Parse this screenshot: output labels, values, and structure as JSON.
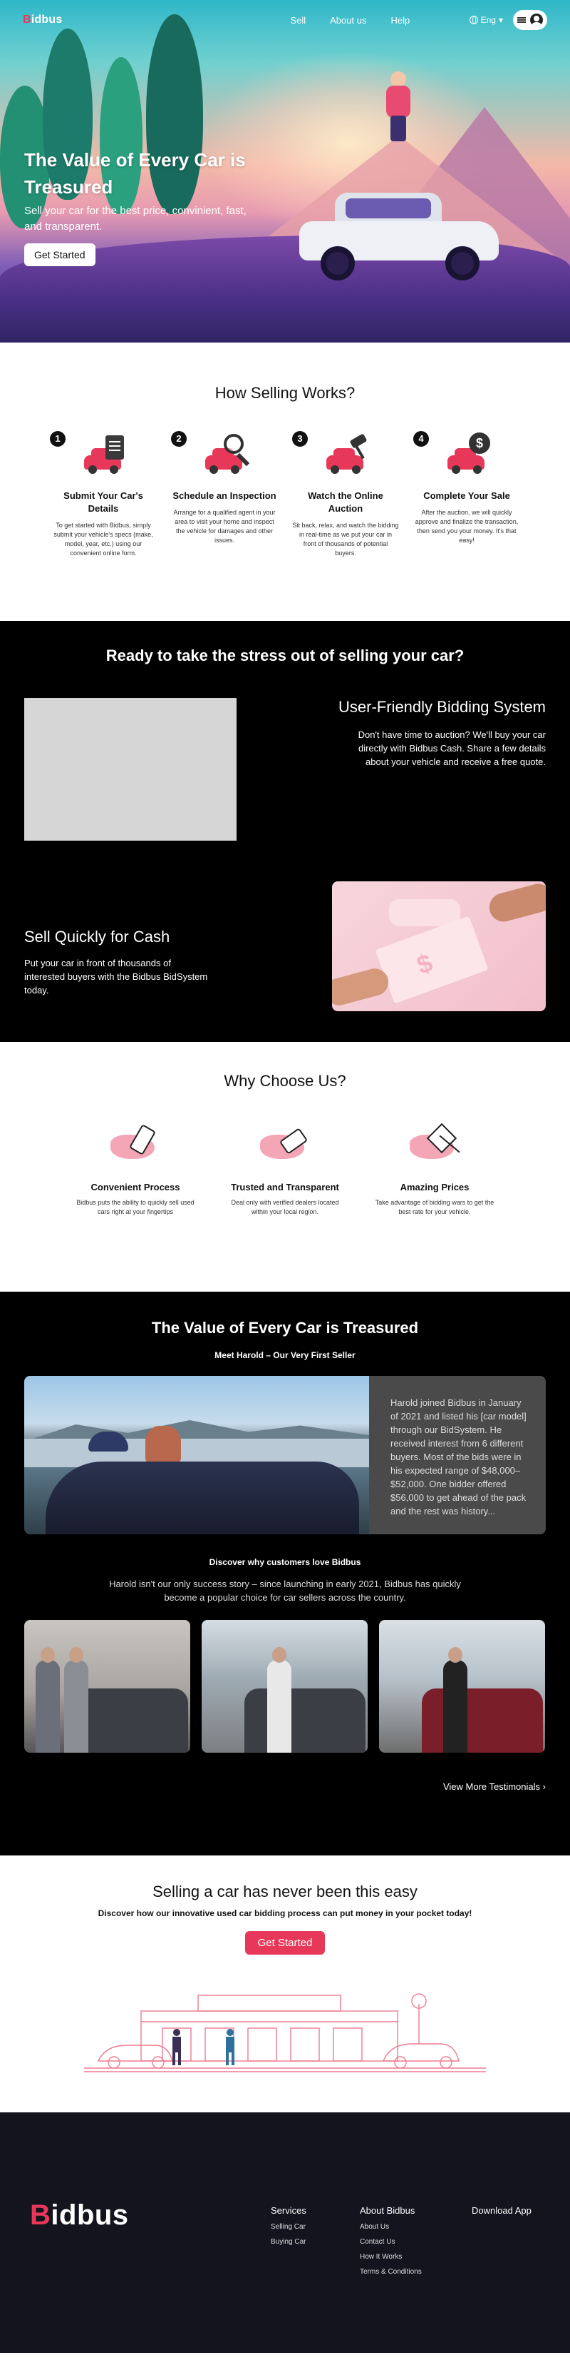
{
  "nav": {
    "logo_prefix": "B",
    "logo_rest": "idbus",
    "links": [
      "Sell",
      "About us",
      "Help"
    ],
    "language": "Eng",
    "language_caret": "▾"
  },
  "hero": {
    "title": "The Value of Every Car is Treasured",
    "subtitle": "Sell your car for the best price, convinient, fast, and transparent.",
    "cta": "Get Started"
  },
  "how": {
    "title": "How Selling Works?",
    "steps": [
      {
        "num": "1",
        "title": "Submit Your Car's Details",
        "text": "To get started with Bidbus, simply submit your vehicle's specs (make, model, year, etc.) using our convenient online form."
      },
      {
        "num": "2",
        "title": "Schedule an Inspection",
        "text": "Arrange for a qualified agent in your area to visit your home and inspect the vehicle for damages and other issues."
      },
      {
        "num": "3",
        "title": "Watch the Online Auction",
        "text": "Sit back, relax, and watch the bidding in real-time as we put your car in front of thousands of potential buyers."
      },
      {
        "num": "4",
        "title": "Complete Your Sale",
        "text": "After the auction, we will quickly approve and finalize the transaction, then send you your money. It's that easy!"
      }
    ]
  },
  "bidding": {
    "title": "Ready to take the stress out of selling your car?",
    "ubs_title": "User-Friendly Bidding System",
    "ubs_text": "Don't have time to auction? We'll buy your car directly with Bidbus Cash. Share a few details about your vehicle and receive a free quote.",
    "cash_title": "Sell Quickly for Cash",
    "cash_text": "Put your car in front of thousands of interested buyers with the Bidbus BidSystem today.",
    "cash_symbol": "$"
  },
  "why": {
    "title": "Why Choose Us?",
    "items": [
      {
        "title": "Convenient Process",
        "text": "Bidbus puts the ability to quickly sell used cars right at your fingertips"
      },
      {
        "title": "Trusted and Transparent",
        "text": "Deal only with verified dealers located within your local region."
      },
      {
        "title": "Amazing Prices",
        "text": "Take advantage of bidding wars to get the best rate for your vehicle."
      }
    ]
  },
  "testimonial": {
    "title": "The Value of Every Car is Treasured",
    "meet": "Meet Harold – Our Very First Seller",
    "harold_text": "Harold joined Bidbus in January of 2021 and listed his [car model] through our BidSystem. He received interest from 6 different buyers. Most of the bids were in his expected range of $48,000–$52,000. One bidder offered $56,000 to get ahead of the pack and the rest was history...",
    "discover_title": "Discover why customers love Bidbus",
    "discover_text": "Harold isn't our only success story – since launching in early 2021, Bidbus has quickly become a popular choice for car sellers across the country.",
    "more": "View More Testimonials",
    "more_icon": "›"
  },
  "cta": {
    "title": "Selling a car has never been this easy",
    "subtitle": "Discover how our innovative used car bidding process can put money in your pocket today!",
    "button": "Get Started"
  },
  "footer": {
    "logo_prefix": "B",
    "logo_rest": "idbus",
    "col1": {
      "title": "Services",
      "links": [
        "Selling Car",
        "Buying Car"
      ]
    },
    "col2": {
      "title": "About Bidbus",
      "links": [
        "About Us",
        "Contact Us",
        "How It Works",
        "Terms & Conditions"
      ]
    },
    "col3": {
      "title": "Download App"
    }
  },
  "colors": {
    "brand": "#e8385a",
    "dark": "#000000",
    "footer": "#14141f"
  },
  "icons": [
    "globe-icon",
    "menu-icon",
    "user-avatar-icon",
    "clipboard-car-icon",
    "magnifier-car-icon",
    "gavel-car-icon",
    "dollar-car-icon",
    "phone-hand-icon",
    "handshake-icon",
    "price-tag-icon",
    "chevron-right-icon"
  ]
}
